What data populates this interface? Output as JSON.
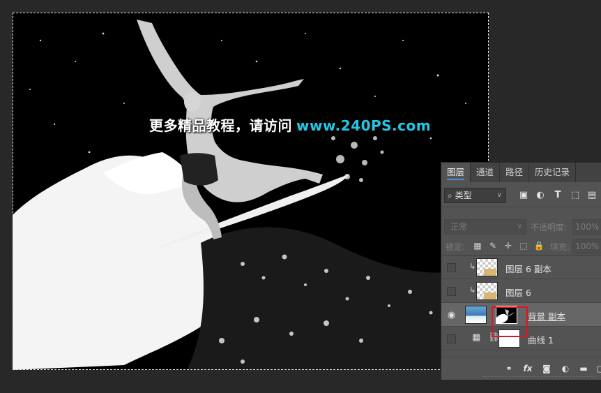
{
  "canvas": {
    "watermark_cn": "更多精品教程，请访问",
    "watermark_url": "www.240PS.com",
    "watermark_cn_color": "#ffffff",
    "watermark_url_color": "#22c8e8"
  },
  "layers_panel": {
    "tabs": [
      {
        "label": "图层",
        "active": true
      },
      {
        "label": "通道",
        "active": false
      },
      {
        "label": "路径",
        "active": false
      },
      {
        "label": "历史记录",
        "active": false
      }
    ],
    "filter": {
      "select_label": "类型",
      "icons": [
        "image-filter-icon",
        "adjustment-filter-icon",
        "type-filter-icon",
        "shape-filter-icon",
        "smart-object-filter-icon"
      ]
    },
    "blend_mode": "正常",
    "opacity_label": "不透明度:",
    "opacity_value": "100%",
    "lock_label": "锁定:",
    "fill_label": "填充:",
    "fill_value": "100%",
    "layers": [
      {
        "name": "图层 6 副本",
        "visible": false,
        "clipped": true,
        "thumb": "transparent",
        "selected": false
      },
      {
        "name": "图层 6",
        "visible": false,
        "clipped": true,
        "thumb": "transparent",
        "selected": false
      },
      {
        "name": "背景 副本",
        "visible": true,
        "clipped": false,
        "thumb": "photo-with-mask",
        "selected": true
      },
      {
        "name": "曲线 1",
        "visible": false,
        "clipped": false,
        "thumb": "curves-adjustment",
        "selected": false
      }
    ],
    "footer_icons": [
      "link-layers-icon",
      "fx-icon",
      "add-mask-icon",
      "adjustment-layer-icon",
      "new-group-icon",
      "new-layer-icon"
    ],
    "accent_color": "#4a90e2",
    "highlight_color": "#e0141e"
  }
}
